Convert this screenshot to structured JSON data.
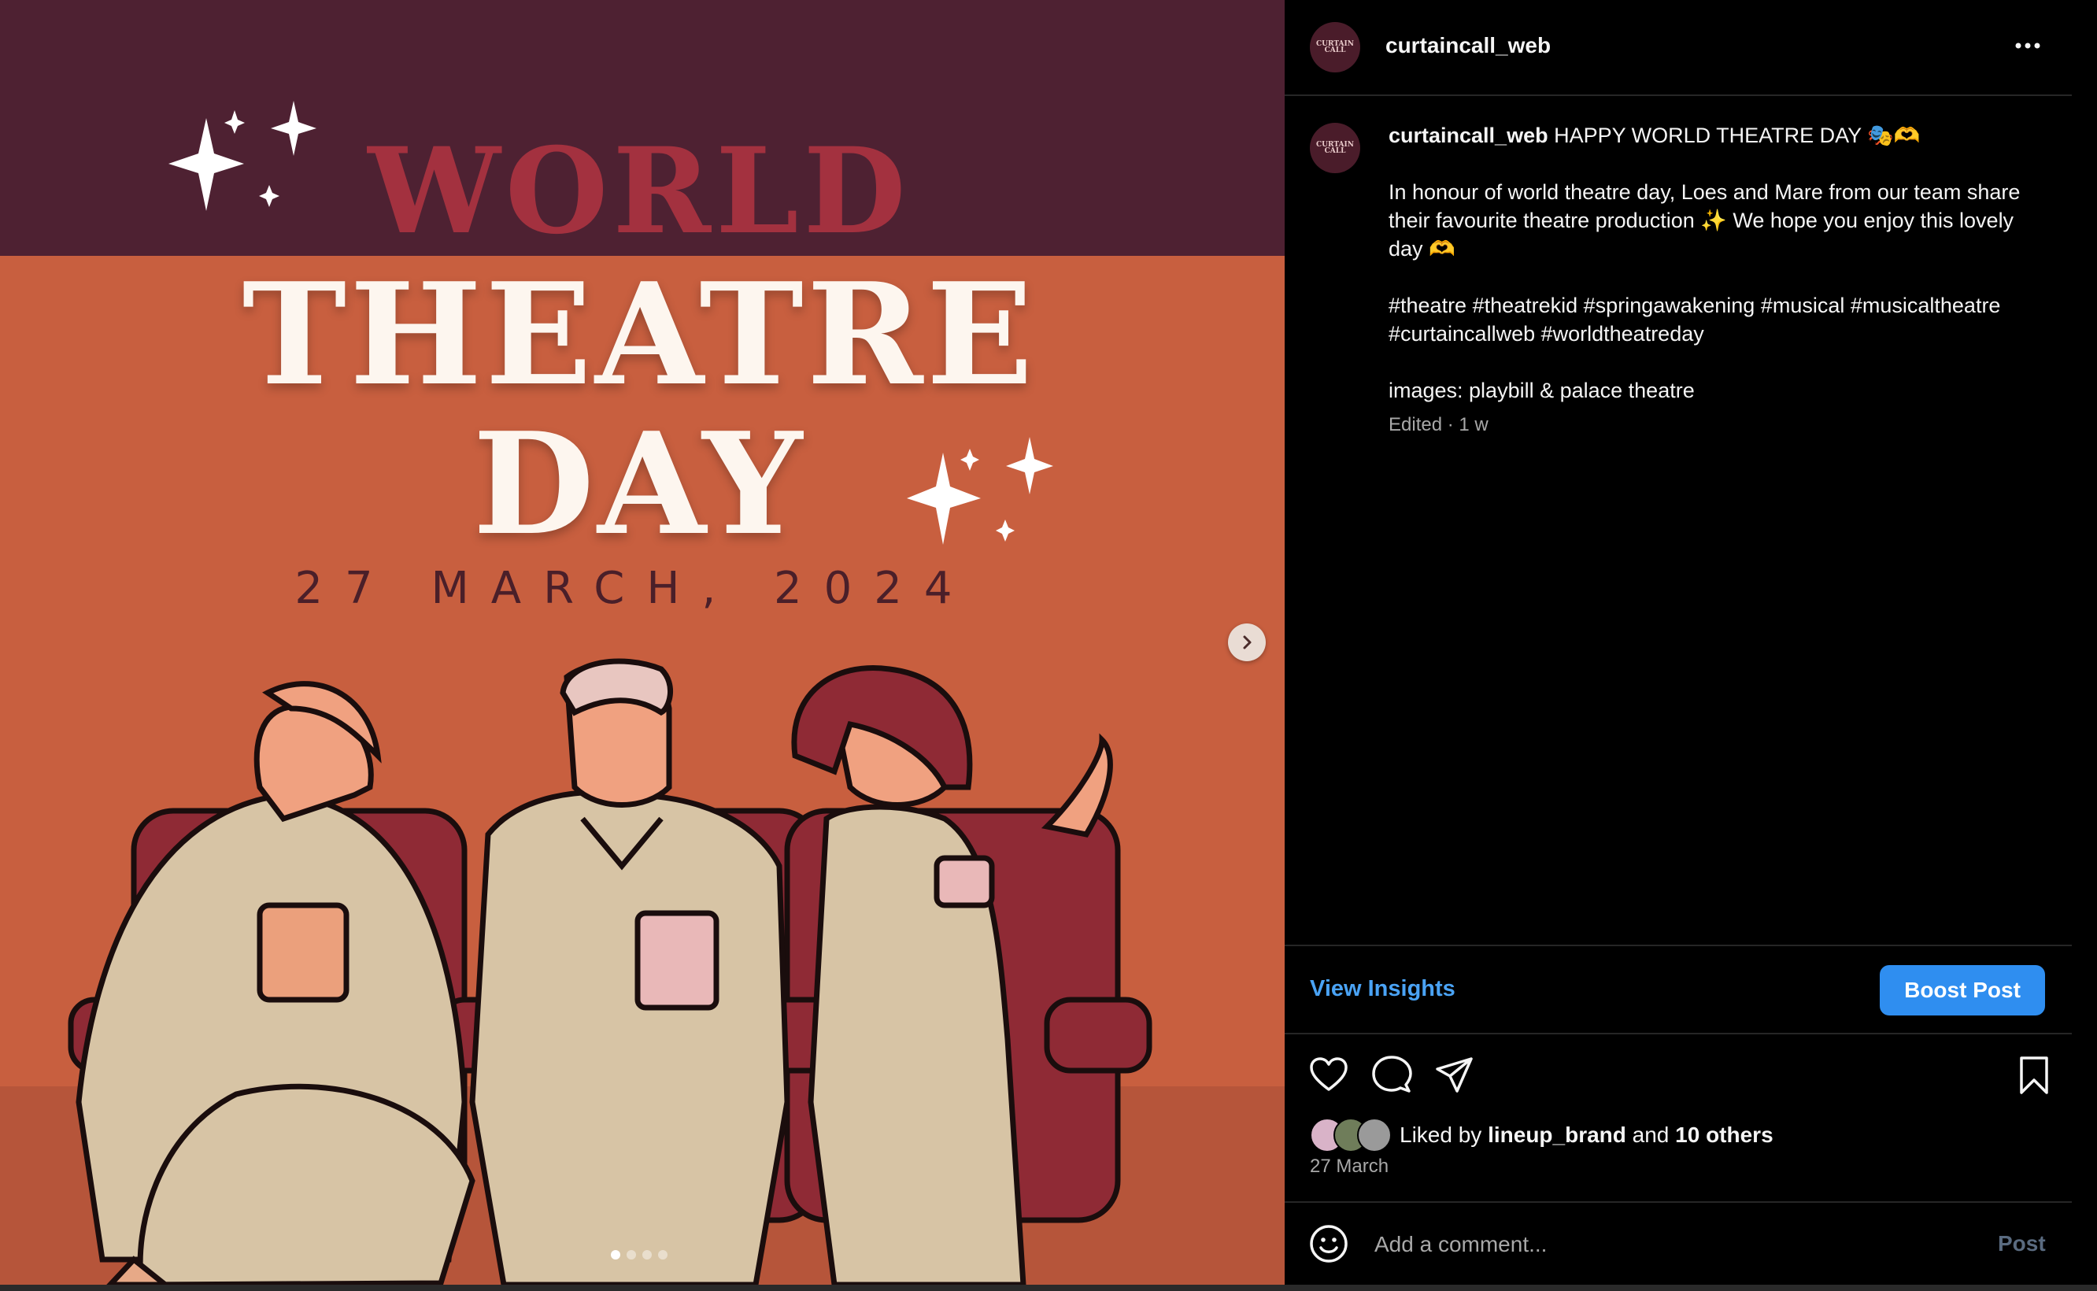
{
  "poster": {
    "line1": "WORLD",
    "line2": "THEATRE",
    "line3": "DAY",
    "date": "27 MARCH, 2024"
  },
  "carousel": {
    "slides": 4,
    "active_index": 0
  },
  "header": {
    "username": "curtaincall_web",
    "avatar_text": "CURTAIN CALL"
  },
  "caption": {
    "username": "curtaincall_web",
    "text": " HAPPY WORLD THEATRE DAY 🎭🫶\n\nIn honour of world theatre day, Loes and Mare from our team share their favourite theatre production ✨ We hope you enjoy this lovely day 🫶\n\n#theatre #theatrekid #springawakening #musical #musicaltheatre #curtaincallweb #worldtheatreday\n\nimages: playbill & palace theatre",
    "meta": "Edited · 1 w"
  },
  "actions": {
    "insights_label": "View Insights",
    "boost_label": "Boost Post"
  },
  "likes": {
    "prefix": "Liked by ",
    "user": "lineup_brand",
    "middle": " and ",
    "others": "10 others",
    "date": "27 March"
  },
  "comment": {
    "placeholder": "Add a comment...",
    "post_label": "Post"
  },
  "colors": {
    "accent": "#4aa3f5",
    "boost": "#2f8ef0",
    "poster_band": "#4e2132",
    "poster_bg": "#c85f3f"
  }
}
